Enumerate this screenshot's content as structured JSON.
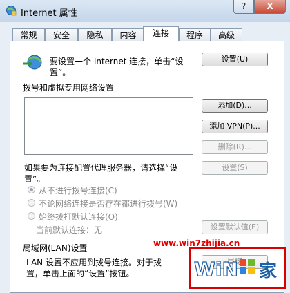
{
  "window": {
    "title": "Internet 属性",
    "help": "?",
    "close": "X"
  },
  "tabs": [
    "常规",
    "安全",
    "隐私",
    "内容",
    "连接",
    "程序",
    "高级"
  ],
  "setup": {
    "text_line1": "要设置一个 Internet 连接，单击“设",
    "text_line2": "置”。",
    "button": "设置(U)"
  },
  "dialup": {
    "heading": "拨号和虚拟专用网络设置",
    "add_button": "添加(D)...",
    "add_vpn_button": "添加 VPN(P)...",
    "delete_button": "删除(R)...",
    "proxy_text_line1": "如果要为连接配置代理服务器，请选择“设",
    "proxy_text_line2": "置”。",
    "settings_button": "设置(S)",
    "radio_never": "从不进行拨号连接(C)",
    "radio_no_network": "不论网络连接是否存在都进行拨号(W)",
    "radio_always": "始终拨打默认连接(O)",
    "current_default": "当前默认连接：无",
    "set_default_button": "设置默认值(E)"
  },
  "lan": {
    "heading": "局域网(LAN)设置",
    "text_line1": "LAN 设置不应用到拨号连接。对于拨",
    "text_line2": "置，单击上面的“设置”按钮。",
    "button": "局域"
  },
  "watermark": {
    "url": "www.win7zhijia.cn",
    "logo": "Win7之家"
  }
}
